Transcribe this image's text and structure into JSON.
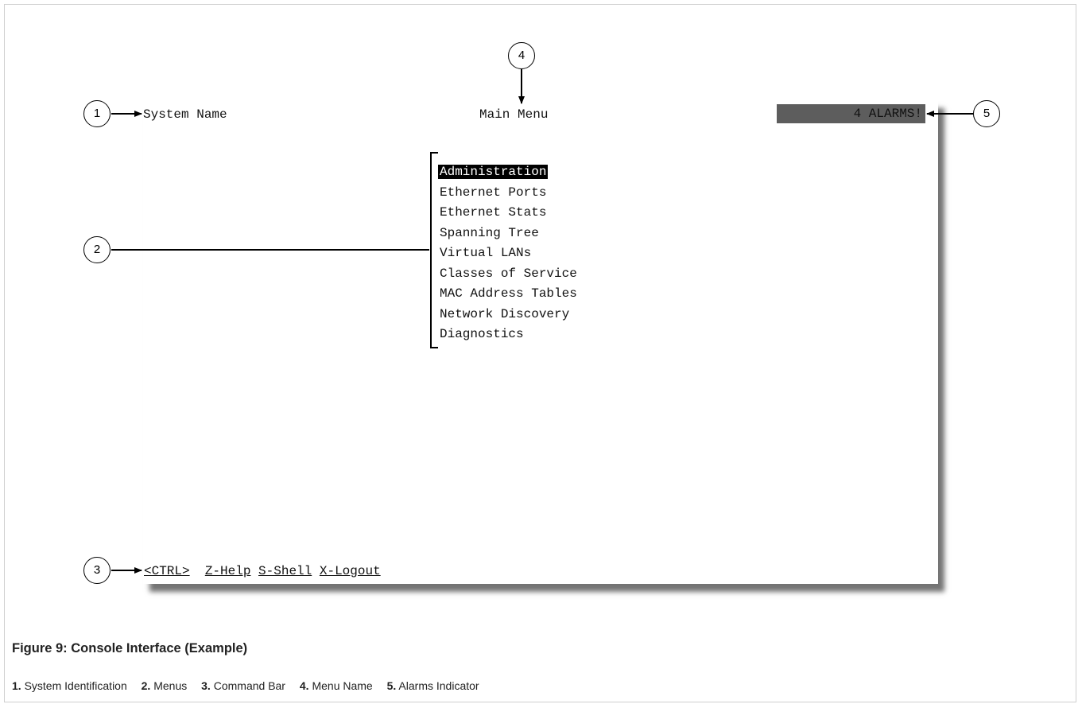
{
  "console": {
    "system_name": "System Name",
    "menu_name": "Main Menu",
    "alarms": "4 ALARMS!",
    "menu_items": [
      "Administration",
      "Ethernet Ports",
      "Ethernet Stats",
      "Spanning Tree",
      "Virtual LANs",
      "Classes of Service",
      "MAC Address Tables",
      "Network Discovery",
      "Diagnostics"
    ],
    "selected_index": 0,
    "command_bar": {
      "ctrl": "<CTRL>",
      "help": "Z-Help",
      "shell": "S-Shell",
      "logout": "X-Logout"
    }
  },
  "callouts": [
    "1",
    "2",
    "3",
    "4",
    "5"
  ],
  "caption": "Figure 9: Console Interface (Example)",
  "legend": [
    {
      "num": "1.",
      "label": "System Identification"
    },
    {
      "num": "2.",
      "label": "Menus"
    },
    {
      "num": "3.",
      "label": "Command Bar"
    },
    {
      "num": "4.",
      "label": "Menu Name"
    },
    {
      "num": "5.",
      "label": "Alarms Indicator"
    }
  ]
}
